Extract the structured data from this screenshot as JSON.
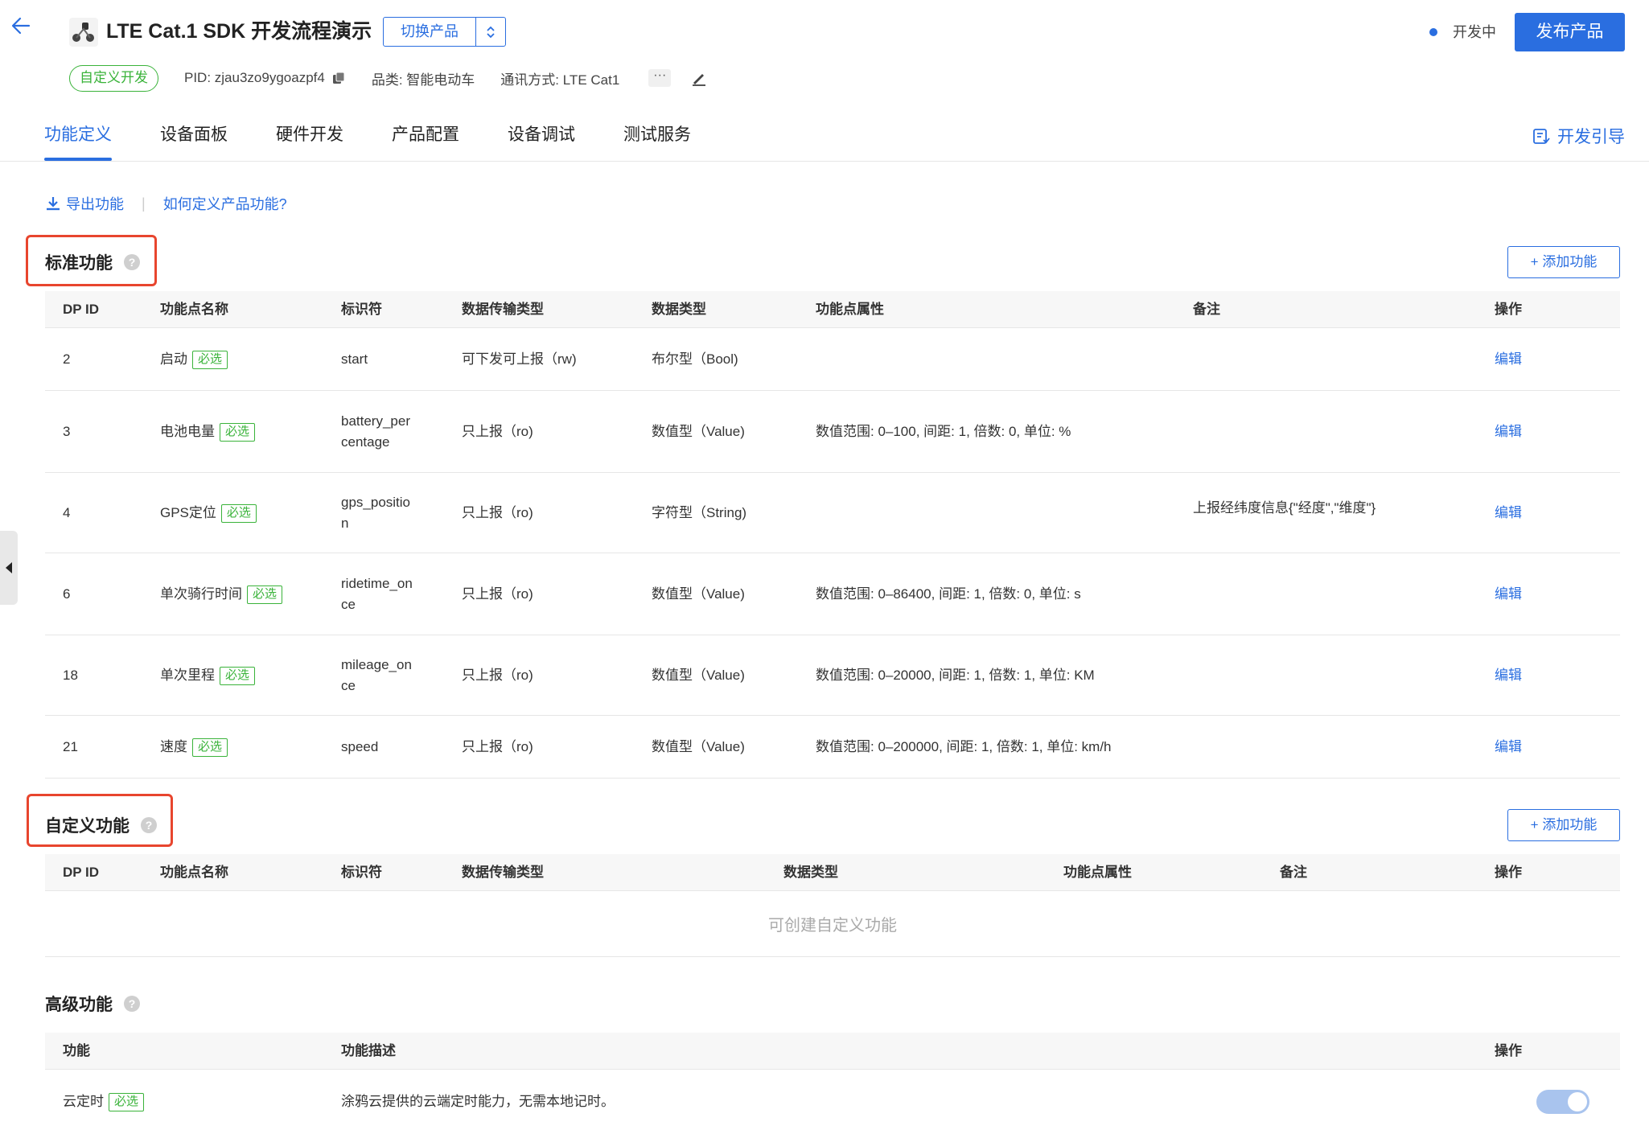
{
  "header": {
    "title": "LTE Cat.1 SDK 开发流程演示",
    "switch_product_label": "切换产品",
    "status_text": "开发中",
    "publish_label": "发布产品",
    "meta": {
      "badge": "自定义开发",
      "pid": "PID: zjau3zo9ygoazpf4",
      "category": "品类: 智能电动车",
      "comm": "通讯方式: LTE Cat1",
      "more": "···"
    },
    "accent_color": "#2a6ee0",
    "success_color": "#3ab33a"
  },
  "tabs": [
    {
      "label": "功能定义",
      "active": true
    },
    {
      "label": "设备面板"
    },
    {
      "label": "硬件开发"
    },
    {
      "label": "产品配置"
    },
    {
      "label": "设备调试"
    },
    {
      "label": "测试服务"
    }
  ],
  "dev_guide_label": "开发引导",
  "toolbar": {
    "export_label": "导出功能",
    "sep": "|",
    "how_to_label": "如何定义产品功能?"
  },
  "standard": {
    "title": "标准功能",
    "add_label": "+ 添加功能",
    "columns": [
      "DP ID",
      "功能点名称",
      "标识符",
      "数据传输类型",
      "数据类型",
      "功能点属性",
      "备注",
      "操作"
    ],
    "required_label": "必选",
    "edit_label": "编辑",
    "rows": [
      {
        "dpid": "2",
        "name": "启动",
        "id1": "start",
        "id2": "",
        "trans": "可下发可上报（rw)",
        "dtype": "布尔型（Bool)",
        "attr": "",
        "note": ""
      },
      {
        "dpid": "3",
        "name": "电池电量",
        "id1": "battery_per",
        "id2": "centage",
        "trans": "只上报（ro)",
        "dtype": "数值型（Value)",
        "attr": "数值范围: 0–100, 间距: 1, 倍数: 0, 单位: %",
        "note": ""
      },
      {
        "dpid": "4",
        "name": "GPS定位",
        "id1": "gps_positio",
        "id2": "n",
        "trans": "只上报（ro)",
        "dtype": "字符型（String)",
        "attr": "",
        "note": "上报经纬度信息{\"经度\",\"维度\"}"
      },
      {
        "dpid": "6",
        "name": "单次骑行时间",
        "id1": "ridetime_on",
        "id2": "ce",
        "trans": "只上报（ro)",
        "dtype": "数值型（Value)",
        "attr": "数值范围: 0–86400, 间距: 1, 倍数: 0, 单位: s",
        "note": ""
      },
      {
        "dpid": "18",
        "name": "单次里程",
        "id1": "mileage_on",
        "id2": "ce",
        "trans": "只上报（ro)",
        "dtype": "数值型（Value)",
        "attr": "数值范围: 0–20000, 间距: 1, 倍数: 1, 单位: KM",
        "note": ""
      },
      {
        "dpid": "21",
        "name": "速度",
        "id1": "speed",
        "id2": "",
        "trans": "只上报（ro)",
        "dtype": "数值型（Value)",
        "attr": "数值范围: 0–200000, 间距: 1, 倍数: 1, 单位: km/h",
        "note": ""
      }
    ]
  },
  "custom": {
    "title": "自定义功能",
    "add_label": "+ 添加功能",
    "columns": [
      "DP ID",
      "功能点名称",
      "标识符",
      "数据传输类型",
      "数据类型",
      "功能点属性",
      "备注",
      "操作"
    ],
    "empty_text": "可创建自定义功能"
  },
  "advanced": {
    "title": "高级功能",
    "columns": [
      "功能",
      "功能描述",
      "操作"
    ],
    "rows": [
      {
        "name": "云定时",
        "desc": "涂鸦云提供的云端定时能力，无需本地记时。",
        "enabled": true
      }
    ]
  }
}
